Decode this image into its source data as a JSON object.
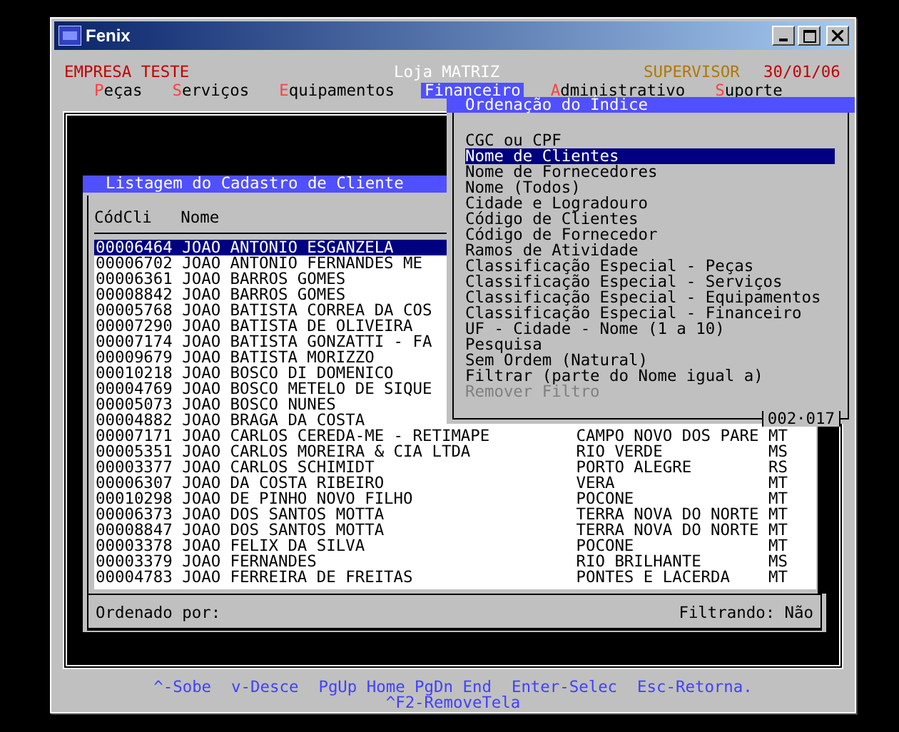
{
  "window": {
    "title": "Fenix"
  },
  "header": {
    "company": "EMPRESA TESTE",
    "store": "Loja MATRIZ",
    "user": "SUPERVISOR",
    "date": "30/01/06"
  },
  "menu": [
    {
      "label": "Peças",
      "selected": false
    },
    {
      "label": "Serviços",
      "selected": false
    },
    {
      "label": "Equipamentos",
      "selected": false
    },
    {
      "label": "Financeiro",
      "selected": true
    },
    {
      "label": "Administrativo",
      "selected": false
    },
    {
      "label": "Suporte",
      "selected": false
    }
  ],
  "list_dialog": {
    "title": "Listagem do Cadastro de Cliente",
    "columns": [
      "CódCli",
      "Nome"
    ],
    "rows": [
      {
        "code": "00006464",
        "name": "JOAO ANTONIO ESGANZELA",
        "selected": true
      },
      {
        "code": "00006702",
        "name": "JOAO ANTONIO FERNANDES ME",
        "selected": false
      },
      {
        "code": "00006361",
        "name": "JOAO BARROS GOMES",
        "selected": false
      },
      {
        "code": "00008842",
        "name": "JOAO BARROS GOMES",
        "selected": false
      },
      {
        "code": "00005768",
        "name": "JOAO BATISTA CORREA DA COS",
        "selected": false
      },
      {
        "code": "00007290",
        "name": "JOAO BATISTA DE OLIVEIRA",
        "selected": false
      },
      {
        "code": "00007174",
        "name": "JOAO BATISTA GONZATTI - FA",
        "selected": false
      },
      {
        "code": "00009679",
        "name": "JOAO BATISTA MORIZZO",
        "selected": false
      },
      {
        "code": "00010218",
        "name": "JOAO BOSCO DI DOMENICO",
        "selected": false
      },
      {
        "code": "00004769",
        "name": "JOAO BOSCO METELO DE SIQUE",
        "selected": false
      },
      {
        "code": "00005073",
        "name": "JOAO BOSCO NUNES",
        "selected": false
      },
      {
        "code": "00004882",
        "name": "JOAO BRAGA DA COSTA",
        "selected": false
      },
      {
        "code": "00007171",
        "name": "JOAO CARLOS CEREDA-ME - RETIMAPE",
        "city": "CAMPO NOVO DOS PARE",
        "uf": "MT",
        "selected": false
      },
      {
        "code": "00005351",
        "name": "JOAO CARLOS MOREIRA & CIA LTDA",
        "city": "RIO VERDE",
        "uf": "MS",
        "selected": false
      },
      {
        "code": "00003377",
        "name": "JOAO CARLOS SCHIMIDT",
        "city": "PORTO ALEGRE",
        "uf": "RS",
        "selected": false
      },
      {
        "code": "00006307",
        "name": "JOAO DA COSTA RIBEIRO",
        "city": "VERA",
        "uf": "MT",
        "selected": false
      },
      {
        "code": "00010298",
        "name": "JOAO DE PINHO NOVO FILHO",
        "city": "POCONE",
        "uf": "MT",
        "selected": false
      },
      {
        "code": "00006373",
        "name": "JOAO DOS SANTOS MOTTA",
        "city": "TERRA NOVA DO NORTE",
        "uf": "MT",
        "selected": false
      },
      {
        "code": "00008847",
        "name": "JOAO DOS SANTOS MOTTA",
        "city": "TERRA NOVA DO NORTE",
        "uf": "MT",
        "selected": false
      },
      {
        "code": "00003378",
        "name": "JOAO FELIX DA SILVA",
        "city": "POCONE",
        "uf": "MT",
        "selected": false
      },
      {
        "code": "00003379",
        "name": "JOAO FERNANDES",
        "city": "RIO BRILHANTE",
        "uf": "MS",
        "selected": false
      },
      {
        "code": "00004783",
        "name": "JOAO FERREIRA DE FREITAS",
        "city": "PONTES E LACERDA",
        "uf": "MT",
        "selected": false
      }
    ],
    "sorted_by": "Ordenado por:",
    "filtering": "Filtrando: Não"
  },
  "order_popup": {
    "title": "Ordenação do Índice",
    "items": [
      {
        "label": "CGC ou CPF",
        "selected": false,
        "disabled": false
      },
      {
        "label": "Nome de Clientes",
        "selected": true,
        "disabled": false
      },
      {
        "label": "Nome de Fornecedores",
        "selected": false,
        "disabled": false
      },
      {
        "label": "Nome (Todos)",
        "selected": false,
        "disabled": false
      },
      {
        "label": "Cidade e Logradouro",
        "selected": false,
        "disabled": false
      },
      {
        "label": "Código de Clientes",
        "selected": false,
        "disabled": false
      },
      {
        "label": "Código de Fornecedor",
        "selected": false,
        "disabled": false
      },
      {
        "label": "Ramos de Atividade",
        "selected": false,
        "disabled": false
      },
      {
        "label": "Classificação Especial - Peças",
        "selected": false,
        "disabled": false
      },
      {
        "label": "Classificação Especial - Serviços",
        "selected": false,
        "disabled": false
      },
      {
        "label": "Classificação Especial - Equipamentos",
        "selected": false,
        "disabled": false
      },
      {
        "label": "Classificação Especial - Financeiro",
        "selected": false,
        "disabled": false
      },
      {
        "label": "UF - Cidade - Nome (1 a 10)",
        "selected": false,
        "disabled": false
      },
      {
        "label": "Pesquisa",
        "selected": false,
        "disabled": false
      },
      {
        "label": "Sem Ordem (Natural)",
        "selected": false,
        "disabled": false
      },
      {
        "label": "Filtrar (parte do Nome igual a)",
        "selected": false,
        "disabled": false
      },
      {
        "label": "Remover Filtro",
        "selected": false,
        "disabled": true
      }
    ],
    "counter": "002·017"
  },
  "help_lines": [
    [
      "^-Sobe",
      "v-Desce",
      "PgUp Home PgDn End",
      "Enter-Selec",
      "Esc-Retorna."
    ],
    [
      "^F2-RemoveTela"
    ]
  ]
}
